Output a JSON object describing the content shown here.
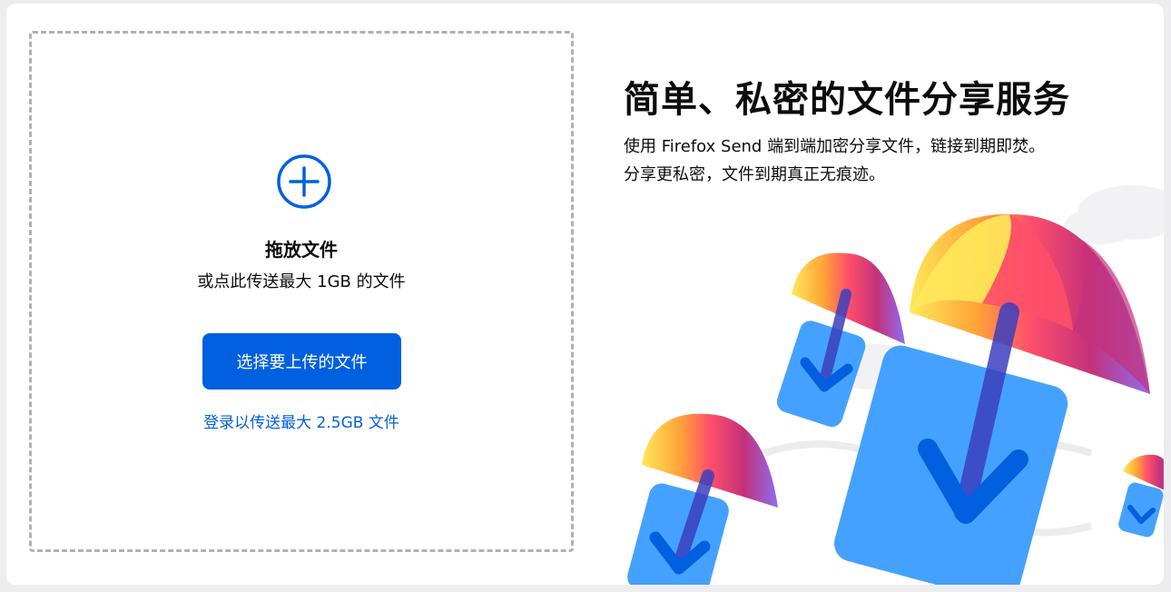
{
  "upload": {
    "drop_title": "拖放文件",
    "drop_subtitle": "或点此传送最大 1GB 的文件",
    "select_button_label": "选择要上传的文件",
    "signin_link_label": "登录以传送最大 2.5GB 文件"
  },
  "intro": {
    "title": "简单、私密的文件分享服务",
    "description": "使用 Firefox Send 端到端加密分享文件，链接到期即焚。分享更私密，文件到期真正无痕迹。"
  },
  "colors": {
    "accent": "#0060df",
    "link": "#0060df",
    "background": "#ededf0",
    "card": "#ffffff"
  },
  "icons": {
    "add": "plus-circle-icon"
  }
}
